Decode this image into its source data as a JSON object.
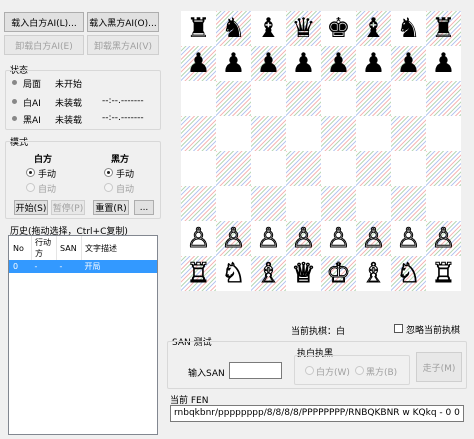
{
  "buttons": {
    "load_white_ai": "载入白方AI(L)...",
    "load_black_ai": "载入黑方AI(O)...",
    "unload_white_ai": "卸载白方AI(E)",
    "unload_black_ai": "卸载黑方AI(V)",
    "start": "开始(S)",
    "pause": "暂停(P)",
    "reset": "重置(R)",
    "more": "...",
    "send": "走子(M)"
  },
  "status": {
    "title": "状态",
    "rows": [
      {
        "label": "局面",
        "value": "未开始",
        "extra": ""
      },
      {
        "label": "白AI",
        "value": "未装载",
        "extra": "--:--.-------"
      },
      {
        "label": "黑AI",
        "value": "未装载",
        "extra": "--:--.-------"
      }
    ]
  },
  "mode": {
    "title": "模式",
    "white_header": "白方",
    "black_header": "黑方",
    "manual": "手动",
    "auto": "自动"
  },
  "history": {
    "title": "历史(拖动选择，Ctrl+C复制)",
    "columns": [
      "No",
      "行动方",
      "SAN",
      "文字描述"
    ],
    "rows": [
      {
        "no": "0",
        "side": "-",
        "san": "-",
        "desc": "开局"
      }
    ]
  },
  "board": {
    "ranks": [
      [
        "♜",
        "♞",
        "♝",
        "♛",
        "♚",
        "♝",
        "♞",
        "♜"
      ],
      [
        "♟",
        "♟",
        "♟",
        "♟",
        "♟",
        "♟",
        "♟",
        "♟"
      ],
      [
        "",
        "",
        "",
        "",
        "",
        "",
        "",
        ""
      ],
      [
        "",
        "",
        "",
        "",
        "",
        "",
        "",
        ""
      ],
      [
        "",
        "",
        "",
        "",
        "",
        "",
        "",
        ""
      ],
      [
        "",
        "",
        "",
        "",
        "",
        "",
        "",
        ""
      ],
      [
        "♙",
        "♙",
        "♙",
        "♙",
        "♙",
        "♙",
        "♙",
        "♙"
      ],
      [
        "♖",
        "♘",
        "♗",
        "♕",
        "♔",
        "♗",
        "♘",
        "♖"
      ]
    ],
    "colors": {
      "dark_stripes": [
        "#f6b8b8",
        "#b8d8b8",
        "#b8c8f0"
      ],
      "light": "#ffffff",
      "accent": "#3399ff"
    }
  },
  "current_turn": "当前执棋：白",
  "ignore_turn": "忽略当前执棋",
  "san_test": {
    "title": "SAN 测试",
    "input_label": "输入SAN",
    "input_value": "",
    "exec_title": "执白执黑",
    "white_opt": "白方(W)",
    "black_opt": "黑方(B)"
  },
  "fen": {
    "label": "当前 FEN",
    "value": "rnbqkbnr/pppppppp/8/8/8/8/PPPPPPPP/RNBQKBNR w KQkq - 0 0"
  }
}
